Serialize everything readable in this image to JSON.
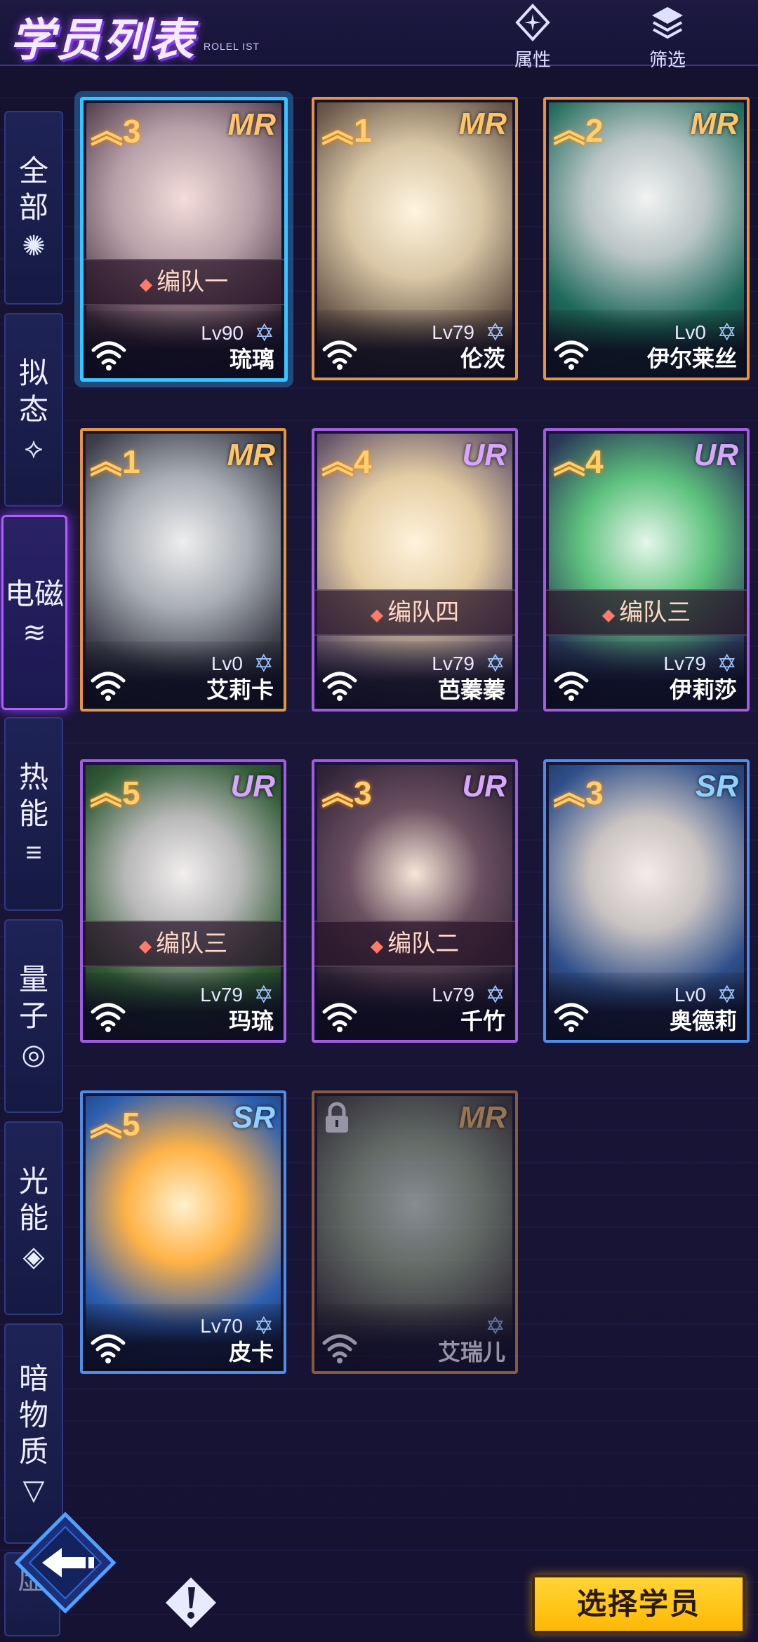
{
  "header": {
    "title": "学员列表",
    "subtitle": "ROLEL IST",
    "attr_label": "属性",
    "filter_label": "筛选"
  },
  "sidebar": {
    "tabs": [
      {
        "label": "全部",
        "icon": "aperture-icon",
        "glyph": "✺"
      },
      {
        "label": "拟态",
        "icon": "nodes-icon",
        "glyph": "⟡"
      },
      {
        "label": "电磁",
        "icon": "wifi-icon",
        "glyph": "≋",
        "active": true
      },
      {
        "label": "热能",
        "icon": "heat-icon",
        "glyph": "≡"
      },
      {
        "label": "量子",
        "icon": "quantum-icon",
        "glyph": "◎"
      },
      {
        "label": "光能",
        "icon": "light-icon",
        "glyph": "◈"
      },
      {
        "label": "暗物质",
        "icon": "dark-matter-icon",
        "glyph": "▽"
      }
    ],
    "partial_tab": "虚"
  },
  "cards": [
    {
      "stars": "3",
      "rarity": "MR",
      "level": "Lv90",
      "name": "琉璃",
      "team": "编队一",
      "selected": true
    },
    {
      "stars": "1",
      "rarity": "MR",
      "level": "Lv79",
      "name": "伦茨",
      "team": ""
    },
    {
      "stars": "2",
      "rarity": "MR",
      "level": "Lv0",
      "name": "伊尔莱丝",
      "team": ""
    },
    {
      "stars": "1",
      "rarity": "MR",
      "level": "Lv0",
      "name": "艾莉卡",
      "team": ""
    },
    {
      "stars": "4",
      "rarity": "UR",
      "level": "Lv79",
      "name": "芭蓁蓁",
      "team": "编队四"
    },
    {
      "stars": "4",
      "rarity": "UR",
      "level": "Lv79",
      "name": "伊莉莎",
      "team": "编队三"
    },
    {
      "stars": "5",
      "rarity": "UR",
      "level": "Lv79",
      "name": "玛琉",
      "team": "编队三"
    },
    {
      "stars": "3",
      "rarity": "UR",
      "level": "Lv79",
      "name": "千竹",
      "team": "编队二"
    },
    {
      "stars": "3",
      "rarity": "SR",
      "level": "Lv0",
      "name": "奥德莉",
      "team": ""
    },
    {
      "stars": "5",
      "rarity": "SR",
      "level": "Lv70",
      "name": "皮卡",
      "team": ""
    },
    {
      "stars": "",
      "rarity": "MR",
      "level": "",
      "name": "艾瑞儿",
      "team": "",
      "locked": true
    }
  ],
  "footer": {
    "select_label": "选择学员",
    "back_icon": "back-arrow-icon",
    "help_icon": "exclamation-icon"
  },
  "colors": {
    "mr_border": "#e6953a",
    "ur_border": "#a15ce0",
    "sr_border": "#4e8ee8",
    "selected": "#36c5ff",
    "accent_button": "#ffc41a"
  }
}
